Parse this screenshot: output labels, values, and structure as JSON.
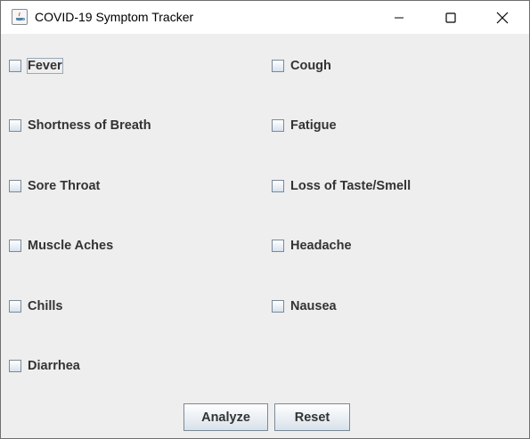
{
  "window": {
    "title": "COVID-19 Symptom Tracker"
  },
  "titlebar": {
    "minimize_icon": "minimize-icon",
    "maximize_icon": "maximize-icon",
    "close_icon": "close-icon",
    "app_icon": "java-icon"
  },
  "symptoms": {
    "fever": "Fever",
    "cough": "Cough",
    "shortness_of_breath": "Shortness of Breath",
    "fatigue": "Fatigue",
    "sore_throat": "Sore Throat",
    "loss_of_taste_smell": "Loss of Taste/Smell",
    "muscle_aches": "Muscle Aches",
    "headache": "Headache",
    "chills": "Chills",
    "nausea": "Nausea",
    "diarrhea": "Diarrhea"
  },
  "buttons": {
    "analyze": "Analyze",
    "reset": "Reset"
  }
}
